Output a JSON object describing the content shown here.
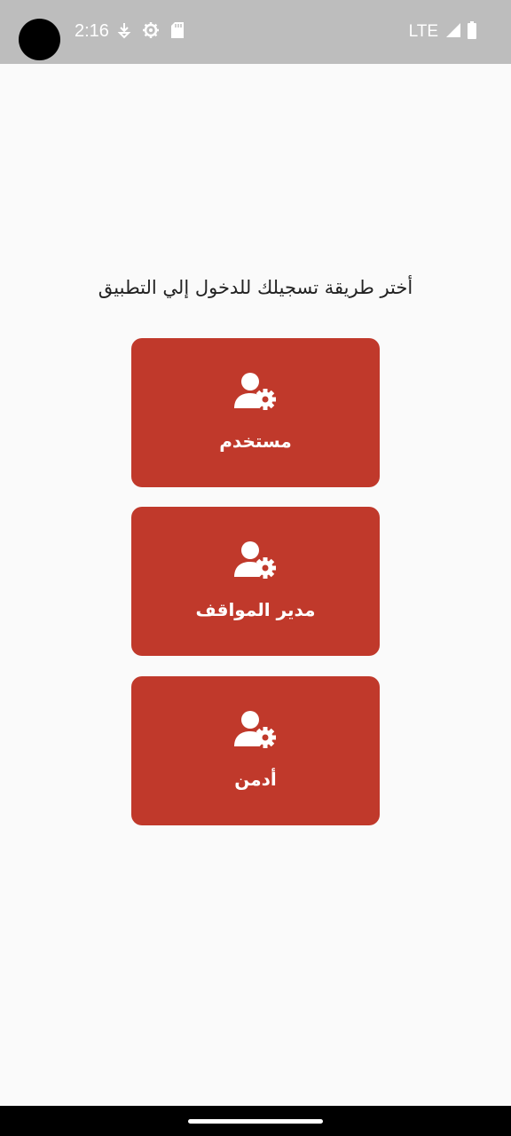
{
  "status_bar": {
    "time": "2:16",
    "network": "LTE",
    "background": "#bdbdbd"
  },
  "main": {
    "title": "أختر طريقة تسجيلك للدخول إلي التطبيق"
  },
  "roles": [
    {
      "label": "مستخدم",
      "icon": "user-gear-icon"
    },
    {
      "label": "مدير المواقف",
      "icon": "user-gear-icon"
    },
    {
      "label": "أدمن",
      "icon": "user-gear-icon"
    }
  ],
  "colors": {
    "accent": "#c0392b",
    "background": "#fafafa",
    "title_text": "#222222"
  }
}
